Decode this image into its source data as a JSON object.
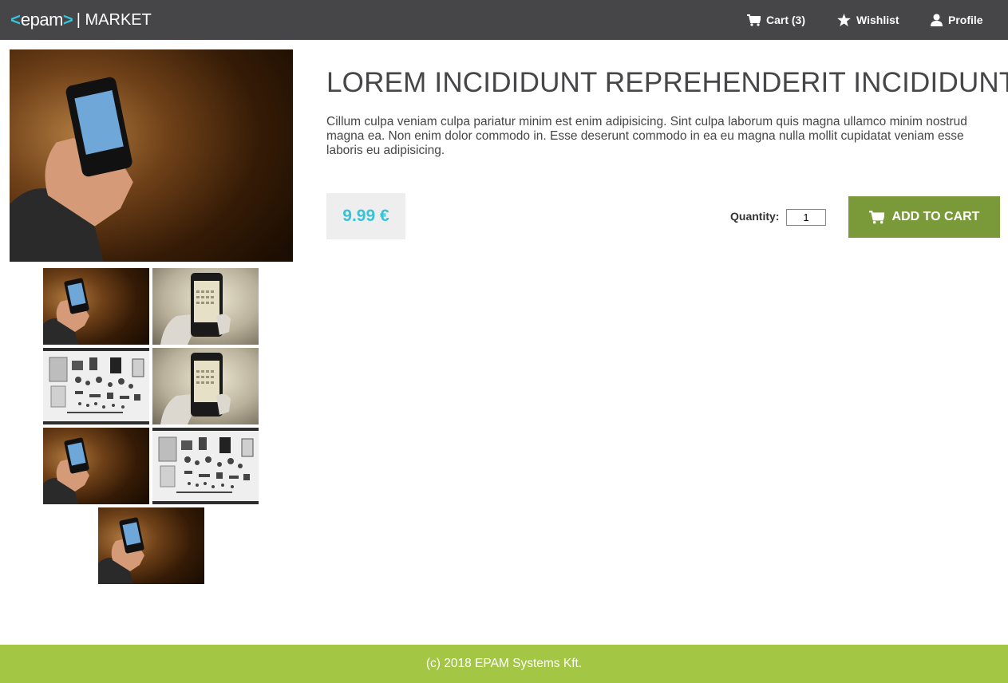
{
  "header": {
    "logo_left": "<",
    "logo_word": "epam",
    "logo_right": ">",
    "title": "| MARKET",
    "nav": {
      "cart": "Cart (3)",
      "wishlist": "Wishlist",
      "profile": "Profile"
    }
  },
  "product": {
    "title": "LOREM INCIDIDUNT REPREHENDERIT INCIDIDUNT",
    "description": "Cillum culpa veniam culpa pariatur minim est enim adipisicing. Sint culpa laborum quis magna ullamco minim nostrud magna ea. Non enim dolor commodo in. Esse deserunt commodo in ea eu magna nulla mollit cupidatat veniam esse laboris eu adipisicing.",
    "price": "9.99 €",
    "quantity_label": "Quantity:",
    "quantity_value": "1",
    "add_to_cart": "ADD TO CART"
  },
  "gallery": {
    "main": "phone-in-hand-photo",
    "thumbnails": [
      "phone-in-hand-photo",
      "phone-calendar-photo",
      "disassembled-phone-parts-photo",
      "phone-calendar-photo",
      "phone-in-hand-photo",
      "disassembled-phone-parts-photo",
      "phone-in-hand-photo"
    ]
  },
  "colors": {
    "header_bg": "#464547",
    "accent_blue": "#39c2d7",
    "button_green": "#7a9a3a",
    "footer_green": "#a3c644"
  },
  "footer": {
    "text": "(c) 2018 EPAM Systems Kft."
  }
}
